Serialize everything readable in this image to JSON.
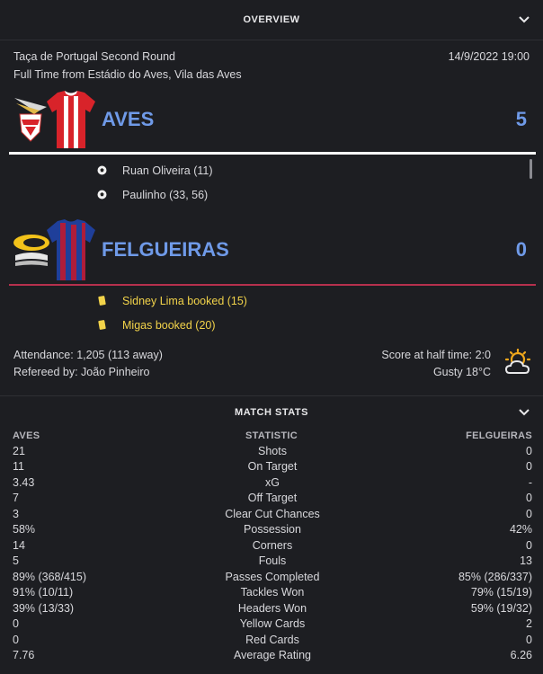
{
  "overview": {
    "title": "OVERVIEW"
  },
  "match": {
    "competition": "Taça de Portugal Second Round",
    "datetime": "14/9/2022 19:00",
    "venue_line": "Full Time from Estádio do Aves, Vila das Aves"
  },
  "home": {
    "name": "AVES",
    "score": "5",
    "kit_colors": {
      "primary": "#d8232a",
      "secondary": "#ffffff"
    },
    "events": [
      {
        "type": "goal",
        "icon": "football-icon",
        "text": "Ruan Oliveira (11)"
      },
      {
        "type": "goal",
        "icon": "football-icon",
        "text": "Paulinho (33, 56)"
      }
    ]
  },
  "away": {
    "name": "FELGUEIRAS",
    "score": "0",
    "kit_colors": {
      "primary": "#1f3f9a",
      "secondary": "#b01d3a"
    },
    "events": [
      {
        "type": "booking",
        "icon": "yellow-card-icon",
        "text": "Sidney Lima booked (15)"
      },
      {
        "type": "booking",
        "icon": "yellow-card-icon",
        "text": "Migas booked (20)"
      }
    ]
  },
  "info": {
    "attendance": "Attendance: 1,205 (113 away)",
    "referee": "Refereed by: João Pinheiro",
    "halftime": "Score at half time: 2:0",
    "weather": "Gusty 18°C",
    "weather_icon": "sun-cloud-icon"
  },
  "stats": {
    "title": "MATCH STATS",
    "col_home": "AVES",
    "col_stat": "STATISTIC",
    "col_away": "FELGUEIRAS",
    "rows": [
      {
        "home": "21",
        "label": "Shots",
        "away": "0"
      },
      {
        "home": "11",
        "label": "On Target",
        "away": "0"
      },
      {
        "home": "3.43",
        "label": "xG",
        "away": "-"
      },
      {
        "home": "7",
        "label": "Off Target",
        "away": "0"
      },
      {
        "home": "3",
        "label": "Clear Cut Chances",
        "away": "0"
      },
      {
        "home": "58%",
        "label": "Possession",
        "away": "42%"
      },
      {
        "home": "14",
        "label": "Corners",
        "away": "0"
      },
      {
        "home": "5",
        "label": "Fouls",
        "away": "13"
      },
      {
        "home": "89% (368/415)",
        "label": "Passes Completed",
        "away": "85% (286/337)"
      },
      {
        "home": "91% (10/11)",
        "label": "Tackles Won",
        "away": "79% (15/19)"
      },
      {
        "home": "39% (13/33)",
        "label": "Headers Won",
        "away": "59% (19/32)"
      },
      {
        "home": "0",
        "label": "Yellow Cards",
        "away": "2"
      },
      {
        "home": "0",
        "label": "Red Cards",
        "away": "0"
      },
      {
        "home": "7.76",
        "label": "Average Rating",
        "away": "6.26"
      }
    ]
  },
  "colors": {
    "team_name": "#6f9ae8",
    "booking_text": "#f2d34a",
    "home_rule": "#ffffff",
    "away_rule": "#b5304d"
  }
}
